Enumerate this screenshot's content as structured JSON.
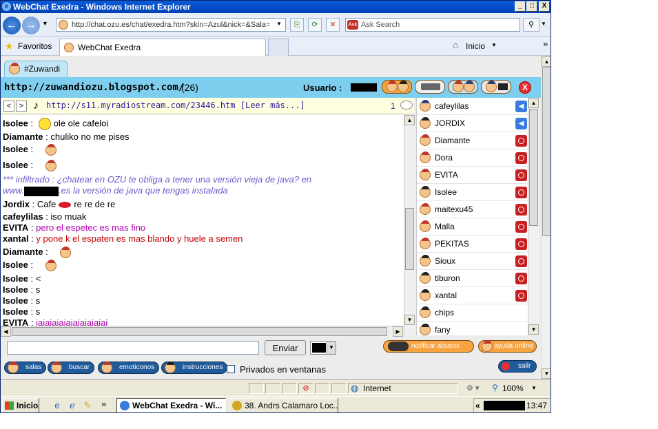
{
  "window": {
    "title": "WebChat Exedra - Windows Internet Explorer",
    "min_label": "_",
    "max_label": "□",
    "close_label": "X"
  },
  "browser": {
    "back_label": "←",
    "forward_label": "→",
    "address": "http://chat.ozu.es/chat/exedra.htm?skin=Azul&nick=&Sala=",
    "search_placeholder": "Ask Search",
    "favorites_label": "Favoritos",
    "tab_title": "WebChat Exedra",
    "home_label": "Inicio",
    "chevron": "»"
  },
  "chat": {
    "room_tab": "#Zuwandi",
    "site_url": "http://zuwandiozu.blogspot.com/",
    "user_count": "(26)",
    "usuario_label": "Usuario :",
    "close_label": "X",
    "radio": {
      "prev": "<",
      "next": ">",
      "text": "http://s11.myradiostream.com/23446.htm [Leer más...]",
      "count": "1"
    },
    "messages": [
      {
        "nick": "Isolee",
        "sep": " : ",
        "text": "ole ole cafeloi",
        "color": "#000000",
        "icon": "smiley"
      },
      {
        "nick": "Diamante",
        "sep": " : ",
        "text": "chuliko no me pises",
        "color": "#000000",
        "icon": ""
      },
      {
        "nick": "Isolee",
        "sep": " : ",
        "text": "",
        "color": "#000000",
        "icon": "face"
      },
      {
        "nick": "Isolee",
        "sep": " : ",
        "text": "",
        "color": "#000000",
        "icon": "face"
      },
      {
        "nick": "",
        "sep": "",
        "text": "*** infiltrado : ¿chatear en OZU te obliga a tener una versión vieja de java? en",
        "color": "#6a5acd",
        "icon": ""
      },
      {
        "nick": "",
        "sep": "",
        "text": "www.",
        "text2": ".es la versión de java que tengas instalada",
        "color": "#6a5acd",
        "icon": ""
      },
      {
        "nick": "Jordix",
        "sep": " : ",
        "text": "Cafe",
        "text2": "re re de re",
        "color": "#000000",
        "icon": "lips"
      },
      {
        "nick": "cafeylilas",
        "sep": " : ",
        "text": "iso muak",
        "color": "#000000",
        "icon": ""
      },
      {
        "nick": "EVITA",
        "sep": " : ",
        "text": "pero el espetec es mas fino",
        "color": "#b000b0",
        "icon": ""
      },
      {
        "nick": "xantal",
        "sep": " : ",
        "text": "y pone k el espaten es mas blando y huele a semen",
        "color": "#c00000",
        "icon": ""
      },
      {
        "nick": "Diamante",
        "sep": " : ",
        "text": "",
        "color": "#000000",
        "icon": "face"
      },
      {
        "nick": "Isolee",
        "sep": " : ",
        "text": "",
        "color": "#000000",
        "icon": "face"
      },
      {
        "nick": "Isolee",
        "sep": " : ",
        "text": "<",
        "color": "#000000",
        "icon": ""
      },
      {
        "nick": "Isolee",
        "sep": " : ",
        "text": "s",
        "color": "#000000",
        "icon": ""
      },
      {
        "nick": "Isolee",
        "sep": " : ",
        "text": "s",
        "color": "#000000",
        "icon": ""
      },
      {
        "nick": "Isolee",
        "sep": " : ",
        "text": "s",
        "color": "#000000",
        "icon": ""
      },
      {
        "nick": "EVITA",
        "sep": " : ",
        "text": "jajajajajajajajajajaj",
        "color": "#b000b0",
        "icon": ""
      }
    ],
    "users": [
      {
        "name": "cafeylilas",
        "status": "mic"
      },
      {
        "name": "JORDIX",
        "status": "mic"
      },
      {
        "name": "Diamante",
        "status": "stop"
      },
      {
        "name": "Dora",
        "status": "stop"
      },
      {
        "name": "EVITA",
        "status": "stop"
      },
      {
        "name": "Isolee",
        "status": "stop"
      },
      {
        "name": "maitexu45",
        "status": "stop"
      },
      {
        "name": "Malla",
        "status": "stop"
      },
      {
        "name": "PEKITAS",
        "status": "stop"
      },
      {
        "name": "Sioux",
        "status": "stop"
      },
      {
        "name": "tiburon",
        "status": "stop"
      },
      {
        "name": "xantal",
        "status": "stop"
      },
      {
        "name": "chips",
        "status": ""
      },
      {
        "name": "fany",
        "status": ""
      }
    ],
    "input_value": "",
    "send_label": "Enviar",
    "notify_label": "notificar abusos",
    "help_label": "ayuda online",
    "nav": {
      "salas": "salas",
      "buscar": "buscar",
      "emoticonos": "emoticonos",
      "instrucciones": "instrucciones",
      "privados": "Privados en ventanas",
      "salir": "salir"
    }
  },
  "status": {
    "zone": "Internet",
    "zoom": "100%"
  },
  "taskbar": {
    "start": "Inicio",
    "task1": "WebChat Exedra - Wi...",
    "task2": "38. Andrs Calamaro   Loc...",
    "tray_chevron": "«",
    "clock": "13:47"
  },
  "colors": {
    "header_bg": "#7ECFEF",
    "accent_orange": "#F6A340",
    "nav_blue": "#1F5A9A",
    "status_red": "#C82020"
  }
}
